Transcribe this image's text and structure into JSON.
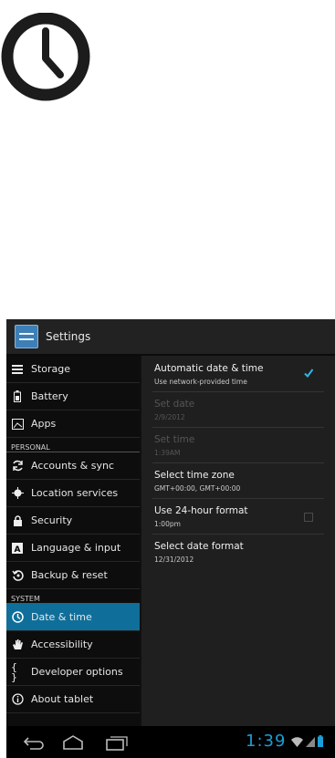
{
  "actionbar": {
    "title": "Settings"
  },
  "sidebar": {
    "items": [
      {
        "label": "Storage",
        "icon": "storage-icon"
      },
      {
        "label": "Battery",
        "icon": "battery-icon"
      },
      {
        "label": "Apps",
        "icon": "apps-icon"
      }
    ],
    "personal_header": "PERSONAL",
    "personal_items": [
      {
        "label": "Accounts & sync",
        "icon": "sync-icon"
      },
      {
        "label": "Location services",
        "icon": "location-icon"
      },
      {
        "label": "Security",
        "icon": "lock-icon"
      },
      {
        "label": "Language & input",
        "icon": "language-icon"
      },
      {
        "label": "Backup & reset",
        "icon": "backup-icon"
      }
    ],
    "system_header": "SYSTEM",
    "system_items": [
      {
        "label": "Date & time",
        "icon": "clock-icon",
        "active": true
      },
      {
        "label": "Accessibility",
        "icon": "hand-icon"
      },
      {
        "label": "Developer options",
        "icon": "braces-icon",
        "glyph": "{ }"
      },
      {
        "label": "About tablet",
        "icon": "info-icon"
      }
    ]
  },
  "prefs": [
    {
      "title": "Automatic date & time",
      "summary": "Use network-provided time",
      "checked": true,
      "enabled": true
    },
    {
      "title": "Set date",
      "summary": "2/9/2012",
      "enabled": false
    },
    {
      "title": "Set time",
      "summary": "1:39AM",
      "enabled": false
    },
    {
      "title": "Select time zone",
      "summary": "GMT+00:00, GMT+00:00",
      "enabled": true
    },
    {
      "title": "Use 24-hour format",
      "summary": "1:00pm",
      "checked": false,
      "enabled": true
    },
    {
      "title": "Select date format",
      "summary": "12/31/2012",
      "enabled": true
    }
  ],
  "status": {
    "time": "1:39"
  },
  "colors": {
    "accent": "#0f6f9a",
    "clock_blue": "#1a9fd8"
  }
}
